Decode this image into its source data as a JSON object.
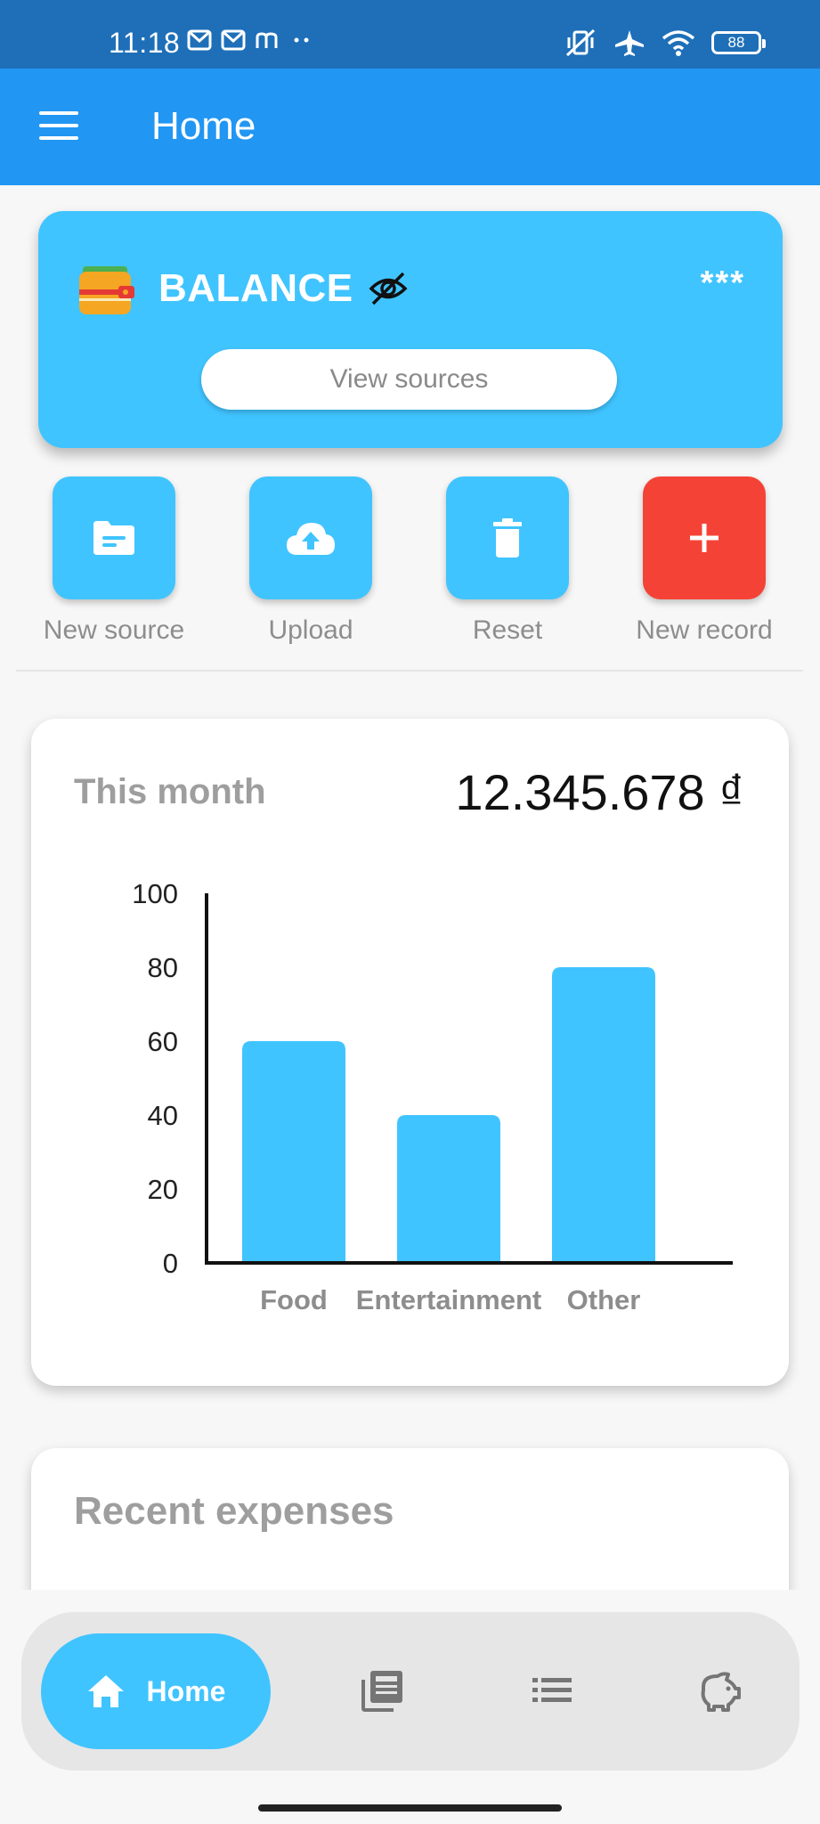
{
  "status_bar": {
    "time": "11:18",
    "battery": "88",
    "icons": [
      "gmail-icon",
      "gmail-icon",
      "m-icon",
      "dots-icon",
      "vibrate-off-icon",
      "airplane-icon",
      "wifi-icon",
      "battery-icon"
    ]
  },
  "app_bar": {
    "title": "Home",
    "menu_icon": "hamburger-icon"
  },
  "balance": {
    "label": "BALANCE",
    "value": "***",
    "view_sources": "View sources",
    "icons": [
      "wallet-icon",
      "eye-off-icon"
    ]
  },
  "actions": [
    {
      "label": "New source",
      "icon": "folder-icon"
    },
    {
      "label": "Upload",
      "icon": "cloud-upload-icon"
    },
    {
      "label": "Reset",
      "icon": "trash-icon"
    },
    {
      "label": "New record",
      "icon": "plus-icon"
    }
  ],
  "colors": {
    "accent": "#40c4ff",
    "app_bar": "#2196f3",
    "status_bar": "#1e6fb8",
    "danger": "#f44336"
  },
  "month": {
    "title": "This month",
    "total": "12.345.678 ₫"
  },
  "chart_data": {
    "type": "bar",
    "categories": [
      "Food",
      "Entertainment",
      "Other"
    ],
    "values": [
      60,
      40,
      80
    ],
    "ylim": [
      0,
      100
    ],
    "yticks": [
      "0",
      "20",
      "40",
      "60",
      "80",
      "100"
    ],
    "grid": false,
    "title": "",
    "xlabel": "",
    "ylabel": ""
  },
  "recent": {
    "title": "Recent expenses"
  },
  "bottom_nav": {
    "home_label": "Home",
    "icons": [
      "home-icon",
      "news-icon",
      "list-icon",
      "piggy-bank-icon"
    ]
  }
}
